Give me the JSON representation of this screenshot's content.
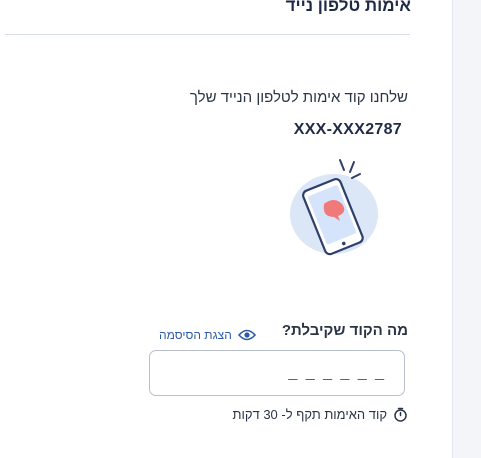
{
  "page": {
    "title": "אימות טלפון נייד",
    "sent_message": "שלחנו קוד אימות לטלפון הנייד שלך",
    "masked_phone": "XXX-XXX2787"
  },
  "form": {
    "question_label": "מה הקוד שקיבלת?",
    "show_password_label": "הצגת הסיסמה",
    "code_placeholder": "_ _ _ _ _ _",
    "validity_text": "קוד האימות תקף ל- 30 דקות"
  },
  "icons": {
    "eye": "eye-icon",
    "timer": "timer-icon",
    "illustration": "phone-message-illustration"
  },
  "colors": {
    "link": "#2e5aa8",
    "text": "#1f2a44",
    "illustration_blob": "#dbe6f7",
    "bubble": "#f07a7a"
  }
}
